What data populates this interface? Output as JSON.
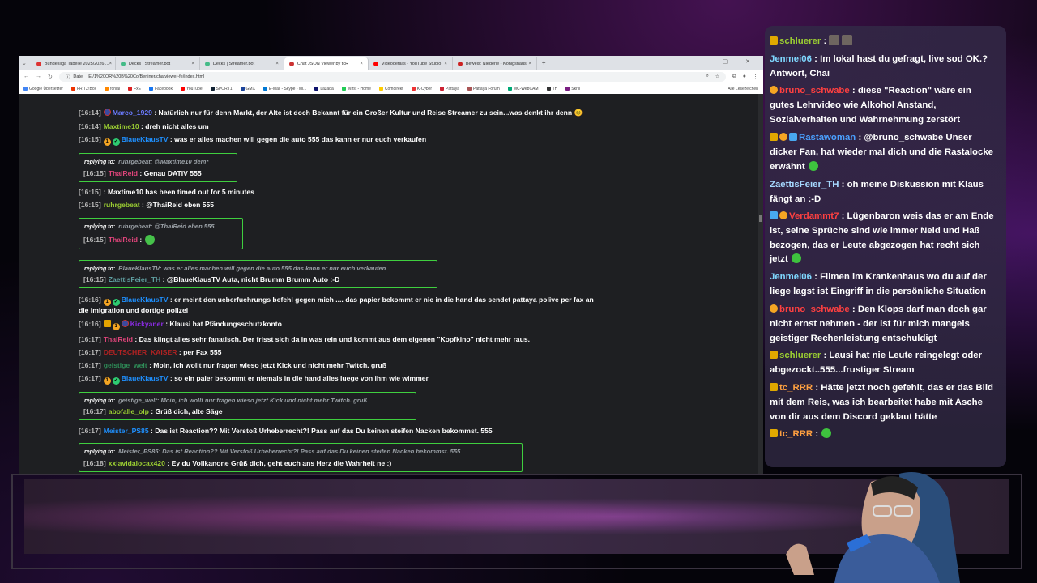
{
  "browser": {
    "tabs": [
      {
        "label": "Bundesliga Tabelle 2025/2026 ...",
        "fav": "#d33",
        "active": false
      },
      {
        "label": "Decks | Streamer.bot",
        "fav": "#4b8",
        "active": false
      },
      {
        "label": "Decks | Streamer.bot",
        "fav": "#4b8",
        "active": false
      },
      {
        "label": "Chat JSON Viewer by tcR",
        "fav": "#c33",
        "active": true
      },
      {
        "label": "Videodetails - YouTube Studio",
        "fav": "#f00",
        "active": false
      },
      {
        "label": "Beweis: Niederle - Königshaus",
        "fav": "#c22",
        "active": false
      }
    ],
    "address_prefix": "Datei",
    "address": "E:/1%20OR%20B%20Co/Berliner/chatviewer-fe/index.html",
    "bookmarks": [
      {
        "label": "Google Übersetzer",
        "color": "#4285f4"
      },
      {
        "label": "FRITZ!Box",
        "color": "#e30"
      },
      {
        "label": "fonial",
        "color": "#f80"
      },
      {
        "label": "FxE",
        "color": "#d22"
      },
      {
        "label": "Facebook",
        "color": "#1877f2"
      },
      {
        "label": "YouTube",
        "color": "#f00"
      },
      {
        "label": "SPORT1",
        "color": "#123"
      },
      {
        "label": "GMX",
        "color": "#1c449b"
      },
      {
        "label": "E-Mail - Skype - Mi...",
        "color": "#0078d4"
      },
      {
        "label": "Lazada",
        "color": "#0f146d"
      },
      {
        "label": "Wirst - Home",
        "color": "#2c5"
      },
      {
        "label": "Comdirekt",
        "color": "#fc0"
      },
      {
        "label": "K-Cyber",
        "color": "#e33"
      },
      {
        "label": "Pattaya",
        "color": "#c23"
      },
      {
        "label": "Pattaya Forum",
        "color": "#a55"
      },
      {
        "label": "MC-WebCAM",
        "color": "#0a7"
      },
      {
        "label": "TH",
        "color": "#333"
      },
      {
        "label": "Skrill",
        "color": "#7a1e82"
      }
    ],
    "bookmarks_end": "Alle Lesezeichen"
  },
  "chat": [
    {
      "ts": "[16:14]",
      "user": "Marco_1929",
      "color": "#6b7bff",
      "badges": [
        "flag"
      ],
      "text": ": Natürlich nur für denn Markt, der Alte ist doch Bekannt für ein Großer Kultur und Reise Streamer zu sein...was denkt ihr denn 😊"
    },
    {
      "ts": "[16:14]",
      "user": "Maxtime10",
      "color": "#9acd32",
      "badges": [],
      "text": ": dreh nicht alles um"
    },
    {
      "ts": "[16:15]",
      "user": "BlaueKlausTV",
      "color": "#1e90ff",
      "badges": [
        "sub",
        "ver"
      ],
      "text": ": was er alles machen will gegen die auto 555 das kann er nur euch verkaufen"
    },
    {
      "reply_label": "replying to:",
      "reply_text": "ruhrgebeat: @Maxtime10 dem*",
      "ts": "[16:15]",
      "user": "ThaiReid",
      "color": "#e0457b",
      "text": ": Genau DATIV 555"
    },
    {
      "ts": "[16:15]",
      "user": "",
      "color": "#fff",
      "badges": [],
      "text": ": Maxtime10 has been timed out for 5 minutes"
    },
    {
      "ts": "[16:15]",
      "user": "ruhrgebeat",
      "color": "#9acd32",
      "badges": [],
      "text": ": @ThaiReid eben 555"
    },
    {
      "reply_label": "replying to:",
      "reply_text": "ruhrgebeat: @ThaiReid eben 555",
      "ts": "[16:15]",
      "user": "ThaiReid",
      "color": "#e0457b",
      "text": ":"
    },
    {
      "reply_label": "replying to:",
      "reply_text": "BlaueKlausTV: was er alles machen will gegen die auto 555 das kann er nur euch verkaufen",
      "ts": "[16:15]",
      "user": "ZaettisFeier_TH",
      "color": "#5f9ea0",
      "text": ": @BlaueKlausTV Auta, nicht Brumm Brumm Auto :-D"
    },
    {
      "ts": "[16:16]",
      "user": "BlaueKlausTV",
      "color": "#1e90ff",
      "badges": [
        "sub",
        "ver"
      ],
      "text": ": er meint den ueberfuehrungs befehl gegen mich .... das papier bekommt er nie in die hand das sendet pattaya polive per fax an",
      "text2": "die imigration und dortige polizei"
    },
    {
      "ts": "[16:16]",
      "user": "Kickyaner",
      "color": "#8a2be2",
      "badges": [
        "crown",
        "sub",
        "flag"
      ],
      "text": ": Klausi hat Pfändungsschutzkonto"
    },
    {
      "ts": "[16:17]",
      "user": "ThaiReid",
      "color": "#e0457b",
      "badges": [],
      "text": ": Das klingt alles sehr fanatisch. Der frisst sich da in was rein und kommt aus dem eigenen \"Kopfkino\" nicht mehr raus."
    },
    {
      "ts": "[16:17]",
      "user": "DEUTSCHER_KAISER",
      "color": "#b22222",
      "badges": [],
      "text": ": per Fax 555"
    },
    {
      "ts": "[16:17]",
      "user": "geistige_welt",
      "color": "#2e8b57",
      "badges": [],
      "text": ": Moin, ich wollt nur fragen wieso jetzt Kick und nicht mehr Twitch. gruß"
    },
    {
      "ts": "[16:17]",
      "user": "BlaueKlausTV",
      "color": "#1e90ff",
      "badges": [
        "sub",
        "ver"
      ],
      "text": ": so ein paier bekommt er niemals in die hand alles luege von ihm wie wimmer"
    },
    {
      "reply_label": "replying to:",
      "reply_text": "geistige_welt: Moin, ich wollt nur fragen wieso jetzt Kick und nicht mehr Twitch. gruß",
      "ts": "[16:17]",
      "user": "abofalle_olp",
      "color": "#9acd32",
      "text": ": Grüß dich, alte Säge"
    },
    {
      "ts": "[16:17]",
      "user": "Meister_PS85",
      "color": "#1e90ff",
      "badges": [],
      "text": ": Das ist Reaction?? Mit Verstoß Urheberrecht?! Pass auf das Du keinen steifen Nacken bekommst. 555"
    },
    {
      "reply_label": "replying to:",
      "reply_text": "Meister_PS85: Das ist Reaction?? Mit Verstoß Urheberrecht?! Pass auf das Du keinen steifen Nacken bekommst. 555",
      "ts": "[16:18]",
      "user": "xxlavidalocax420",
      "color": "#9acd32",
      "text": ": Ey du Vollkanone Grüß dich, geht euch ans Herz die Wahrheit ne :)"
    }
  ],
  "overlay": [
    {
      "user": "schluerer",
      "color": "#9acd32",
      "text": ":"
    },
    {
      "user": "Jenmei06",
      "color": "#7fd8ff",
      "text": ": Im lokal hast du gefragt, live sod OK.? Antwort, Chai"
    },
    {
      "user": "bruno_schwabe",
      "color": "#ff4040",
      "text": ": diese \"Reaction\" wäre ein gutes Lehrvideo wie Alkohol Anstand, Sozialverhalten und Wahrnehmung zerstört"
    },
    {
      "user": "Rastawoman",
      "color": "#4aa0ff",
      "text": ": @bruno_schwabe Unser dicker Fan, hat wieder mal dich und die Rastalocke erwähnt"
    },
    {
      "user": "ZaettisFeier_TH",
      "color": "#a6d8ff",
      "text": ": oh meine Diskussion mit Klaus fängt an :-D"
    },
    {
      "user": "Verdammt7",
      "color": "#ff4040",
      "text": ": Lügenbaron weis das er am Ende ist, seine Sprüche sind wie immer Neid und Haß bezogen, das er Leute abgezogen hat recht sich jetzt"
    },
    {
      "user": "Jenmei06",
      "color": "#7fd8ff",
      "text": ": Filmen im Krankenhaus wo du auf der liege lagst ist Eingriff in die persönliche Situation"
    },
    {
      "user": "bruno_schwabe",
      "color": "#ff4040",
      "text": ": Den Klops darf man doch gar nicht ernst nehmen - der ist für mich mangels geistiger Rechenleistung entschuldigt"
    },
    {
      "user": "schluerer",
      "color": "#9acd32",
      "text": ": Lausi hat nie Leute reingelegt oder abgezockt..555...frustiger Stream"
    },
    {
      "user": "tc_RRR",
      "color": "#ffa040",
      "text": ": Hätte jetzt noch gefehlt, das er das Bild mit dem Reis, was ich bearbeitet habe mit Asche von dir aus dem Discord geklaut hätte"
    },
    {
      "user": "tc_RRR",
      "color": "#ffa040",
      "text": ":"
    }
  ]
}
